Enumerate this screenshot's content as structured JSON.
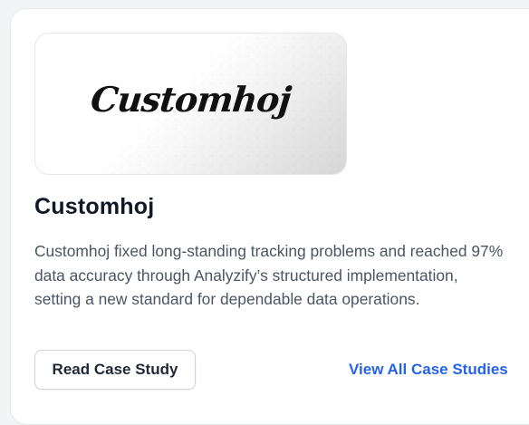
{
  "card": {
    "logo": {
      "wordmark": "Customhoj"
    },
    "title": "Customhoj",
    "description": "Customhoj fixed long-standing tracking problems and reached 97% data accuracy through Analyzify’s structured implementation, setting a new standard for dependable data operations.",
    "primary_button_label": "Read Case Study",
    "secondary_link_label": "View All Case Studies"
  },
  "colors": {
    "link": "#2563eb",
    "title": "#111827",
    "body_text": "#4b5563",
    "border": "#e5e7eb"
  }
}
